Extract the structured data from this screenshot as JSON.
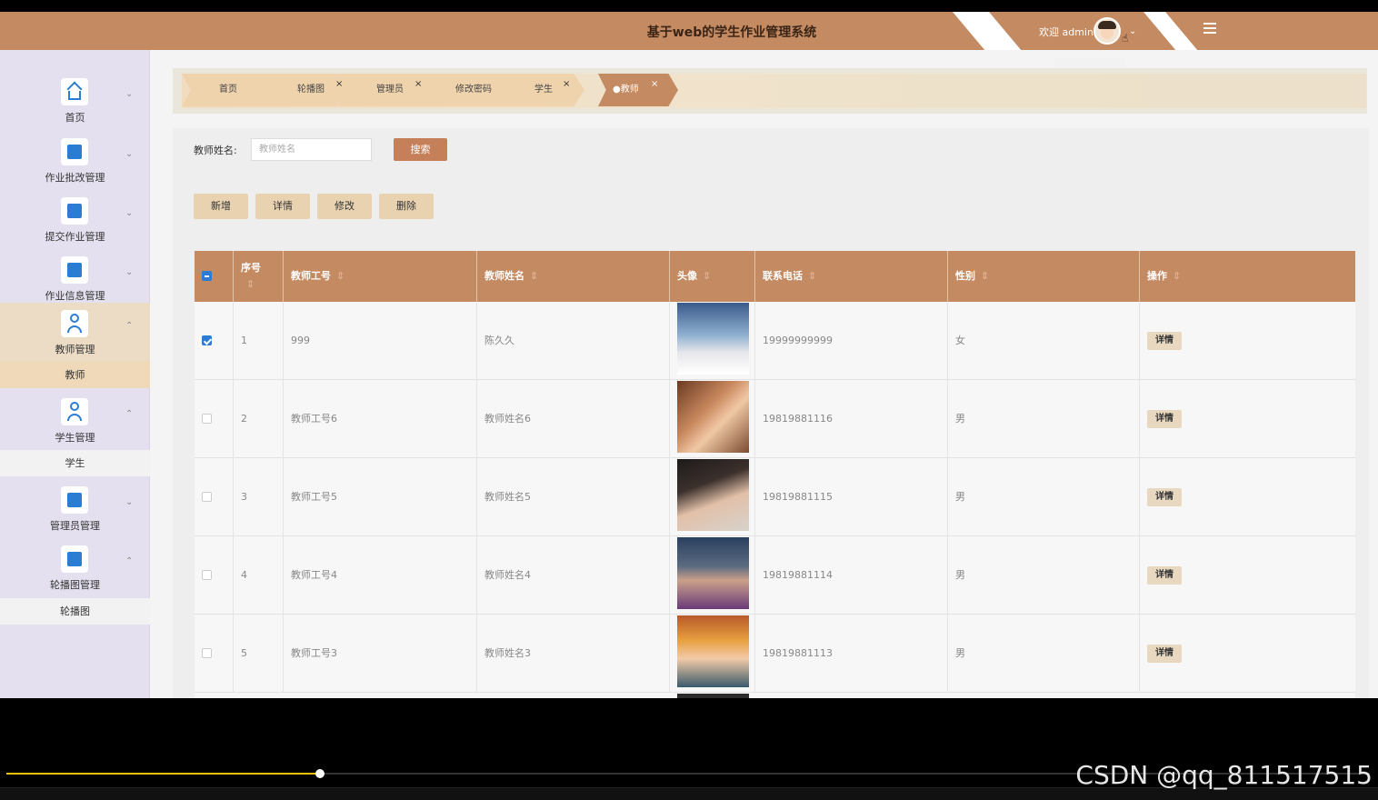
{
  "header": {
    "title": "基于web的学生作业管理系统",
    "welcome": "欢迎 admin"
  },
  "sidebar": {
    "items": [
      {
        "label": "首页",
        "icon": "home-icon"
      },
      {
        "label": "作业批改管理",
        "icon": "chip-icon"
      },
      {
        "label": "提交作业管理",
        "icon": "chart-icon"
      },
      {
        "label": "作业信息管理",
        "icon": "grid-icon"
      },
      {
        "label": "教师管理",
        "icon": "user-icon",
        "sub": "教师"
      },
      {
        "label": "学生管理",
        "icon": "user-icon",
        "sub": "学生"
      },
      {
        "label": "管理员管理",
        "icon": "panel-icon"
      },
      {
        "label": "轮播图管理",
        "icon": "layout-icon",
        "sub": "轮播图"
      }
    ]
  },
  "tabs": [
    {
      "label": "首页"
    },
    {
      "label": "轮播图",
      "close": "×"
    },
    {
      "label": "管理员",
      "close": "×"
    },
    {
      "label": "修改密码",
      "close": "×"
    },
    {
      "label": "学生",
      "close": "×"
    },
    {
      "label": "●教师",
      "close": "×",
      "active": true
    }
  ],
  "search": {
    "label": "教师姓名:",
    "placeholder": "教师姓名",
    "button": "搜索"
  },
  "actions": [
    "新增",
    "详情",
    "修改",
    "删除"
  ],
  "table": {
    "headers": [
      "序号",
      "教师工号",
      "教师姓名",
      "头像",
      "联系电话",
      "性别",
      "操作"
    ],
    "rows": [
      {
        "seq": "1",
        "id": "999",
        "name": "陈久久",
        "phone": "19999999999",
        "gender": "女",
        "checked": true
      },
      {
        "seq": "2",
        "id": "教师工号6",
        "name": "教师姓名6",
        "phone": "19819881116",
        "gender": "男",
        "checked": false
      },
      {
        "seq": "3",
        "id": "教师工号5",
        "name": "教师姓名5",
        "phone": "19819881115",
        "gender": "男",
        "checked": false
      },
      {
        "seq": "4",
        "id": "教师工号4",
        "name": "教师姓名4",
        "phone": "19819881114",
        "gender": "男",
        "checked": false
      },
      {
        "seq": "5",
        "id": "教师工号3",
        "name": "教师姓名3",
        "phone": "19819881113",
        "gender": "男",
        "checked": false
      }
    ],
    "detail_label": "详情"
  },
  "player": {
    "progress": 0.23
  },
  "watermark": "CSDN @qq_811517515",
  "colors": {
    "brand": "#c48a62",
    "sidebar": "#e4e0ef",
    "accent": "#2b7cd3",
    "button_light": "#e8d2b0",
    "progress": "#f2c200"
  }
}
